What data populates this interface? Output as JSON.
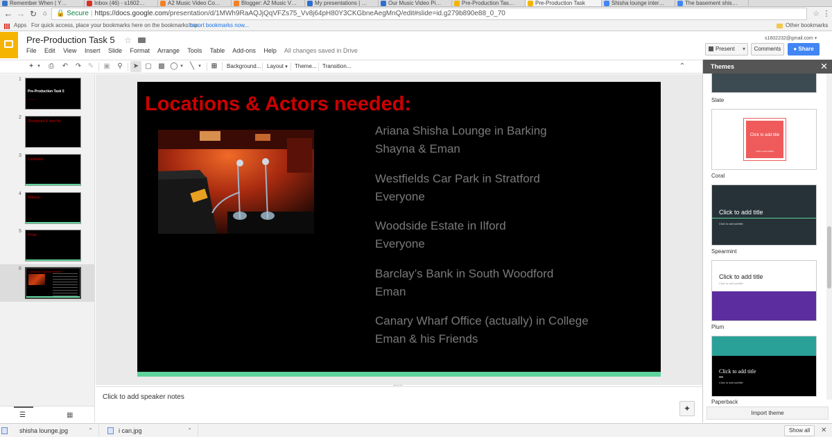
{
  "browser": {
    "tabs": [
      {
        "label": "Remember When | Y…",
        "active": false
      },
      {
        "label": "Inbox (46) - s1602…",
        "active": false
      },
      {
        "label": "A2 Music Video Co…",
        "active": false
      },
      {
        "label": "Blogger: A2 Music V…",
        "active": false
      },
      {
        "label": "My presentations | …",
        "active": false
      },
      {
        "label": "Our Music Video Pi…",
        "active": false
      },
      {
        "label": "Pre-Production Tas…",
        "active": false
      },
      {
        "label": "Pre-Production Task",
        "active": true
      },
      {
        "label": "Shisha lounge inter…",
        "active": false
      },
      {
        "label": "The basement shis…",
        "active": false
      }
    ],
    "secure_label": "Secure",
    "url_host": "https://docs.google.com",
    "url_path": "/presentation/d/1MWh9RaAQJjQqVFZs75_Vv8j64pH80Y3CKGbneAegMnQ/edit#slide=id.g279b890e88_0_70",
    "bookmarks": {
      "apps_label": "Apps",
      "hint": "For quick access, place your bookmarks here on the bookmarks bar.",
      "import_link": "Import bookmarks now...",
      "other": "Other bookmarks"
    }
  },
  "doc": {
    "title": "Pre-Production Task 5",
    "menus": [
      "File",
      "Edit",
      "View",
      "Insert",
      "Slide",
      "Format",
      "Arrange",
      "Tools",
      "Table",
      "Add-ons",
      "Help"
    ],
    "save_status": "All changes saved in Drive",
    "account": "s1602232@gmail.com",
    "present_label": "Present",
    "comments_label": "Comments",
    "share_label": "Share"
  },
  "toolbar": {
    "background": "Background...",
    "layout": "Layout",
    "theme": "Theme...",
    "transition": "Transition..."
  },
  "filmstrip": {
    "slides": [
      {
        "num": "1",
        "text": "Pre-Production Task 5"
      },
      {
        "num": "2",
        "text": "Storyboard & shot list"
      },
      {
        "num": "3",
        "text": "Costumes"
      },
      {
        "num": "4",
        "text": "Makeup"
      },
      {
        "num": "5",
        "text": "Props"
      },
      {
        "num": "6",
        "text": "Locations & Actors needed:"
      }
    ],
    "selected": 6
  },
  "slide": {
    "title": "Locations & Actors needed:",
    "locations": [
      {
        "place": "Ariana Shisha Lounge in Barking",
        "actors": "Shayna & Eman"
      },
      {
        "place": "Westfields Car Park in Stratford",
        "actors": "Everyone"
      },
      {
        "place": "Woodside Estate in Ilford",
        "actors": "Everyone"
      },
      {
        "place": "Barclay’s Bank in South Woodford",
        "actors": "Eman"
      },
      {
        "place": "Canary Wharf Office (actually) in College",
        "actors": "Eman & his Friends"
      }
    ],
    "title_color": "#cc0000",
    "accent_color": "#5fd39b"
  },
  "notes": {
    "placeholder": "Click to add speaker notes"
  },
  "themes": {
    "header": "Themes",
    "items": [
      {
        "name": "Slate",
        "title": "",
        "subtitle": ""
      },
      {
        "name": "Coral",
        "title": "Click to add title",
        "subtitle": "Click to add subtitle"
      },
      {
        "name": "Spearmint",
        "title": "Click to add title",
        "subtitle": "Click to add subtitle"
      },
      {
        "name": "Plum",
        "title": "Click to add title",
        "subtitle": "Click to add subtitle"
      },
      {
        "name": "Paperback",
        "title": "Click to add title",
        "subtitle": "Click to add subtitle"
      }
    ],
    "import_label": "Import theme"
  },
  "downloads": {
    "items": [
      "shisha lounge.jpg",
      "i can.jpg"
    ],
    "show_all": "Show all"
  }
}
